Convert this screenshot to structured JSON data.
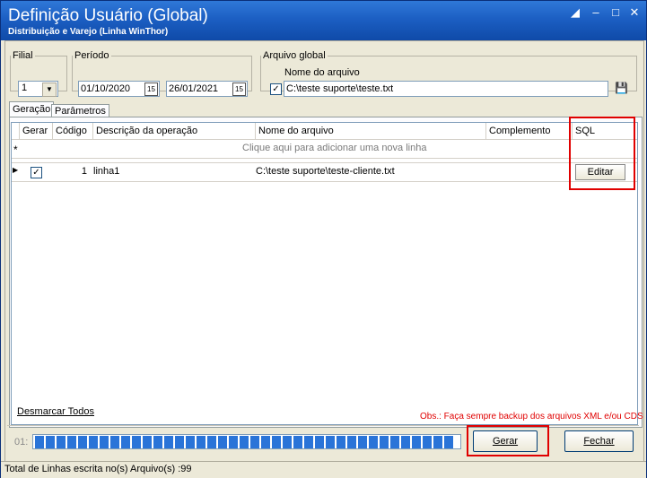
{
  "window": {
    "title": "Definição Usuário (Global)",
    "subtitle": "Distribuição e Varejo (Linha WinThor)"
  },
  "filial": {
    "legend": "Filial",
    "value": "1"
  },
  "periodo": {
    "legend": "Período",
    "start": "01/10/2020",
    "end": "26/01/2021"
  },
  "arquivo_global": {
    "legend": "Arquivo global",
    "field_label": "Nome do arquivo",
    "checked": true,
    "value": "C:\\teste suporte\\teste.txt"
  },
  "tabs": [
    {
      "label": "Geração",
      "active": true
    },
    {
      "label": "Parâmetros",
      "active": false
    }
  ],
  "grid": {
    "columns": [
      "Gerar",
      "Código",
      "Descrição da operação",
      "Nome do arquivo",
      "Complemento",
      "SQL"
    ],
    "new_row_hint": "Clique aqui para adicionar uma nova linha",
    "new_row_marker": "*",
    "rows": [
      {
        "gerar": true,
        "codigo": "1",
        "descricao": "linha1",
        "arquivo": "C:\\teste suporte\\teste-cliente.txt",
        "complemento": "",
        "sql_button": "Editar"
      }
    ]
  },
  "bottom": {
    "desmarcar": "Desmarcar Todos",
    "obs": "Obs.: Faça sempre backup dos arquivos XML e/ou CDS",
    "progress_label": "01:",
    "progress": 1.0,
    "gerar": "Gerar",
    "fechar": "Fechar"
  },
  "status": "Total de Linhas escrita no(s) Arquivo(s) :99",
  "colors": {
    "title_blue": "#1c5fc3",
    "progress_blue": "#2a74d8",
    "highlight_red": "#e00000",
    "obs_red": "#e00000"
  }
}
